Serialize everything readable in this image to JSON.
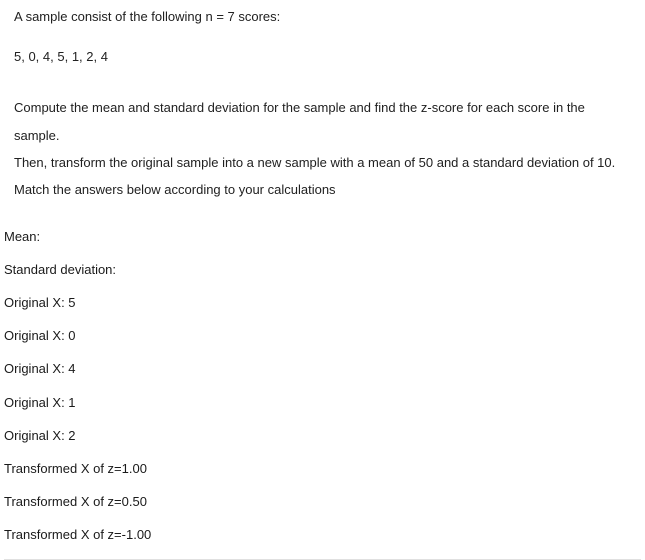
{
  "intro": "A sample consist of the following n = 7 scores:",
  "scores": "5, 0, 4, 5, 1, 2, 4",
  "instruction1": "Compute the mean and standard deviation for the sample and find the z-score for each score in the sample.",
  "instruction2": "Then, transform the original sample into a new sample with a mean of 50 and a standard deviation of 10.",
  "instruction3": "Match the answers below according to your calculations",
  "items": [
    "Mean:",
    "Standard deviation:",
    "Original X: 5",
    "Original X: 0",
    "Original X: 4",
    "Original X: 1",
    "Original X: 2",
    "Transformed X of z=1.00",
    "Transformed X of z=0.50",
    "Transformed X of z=-1.00"
  ]
}
